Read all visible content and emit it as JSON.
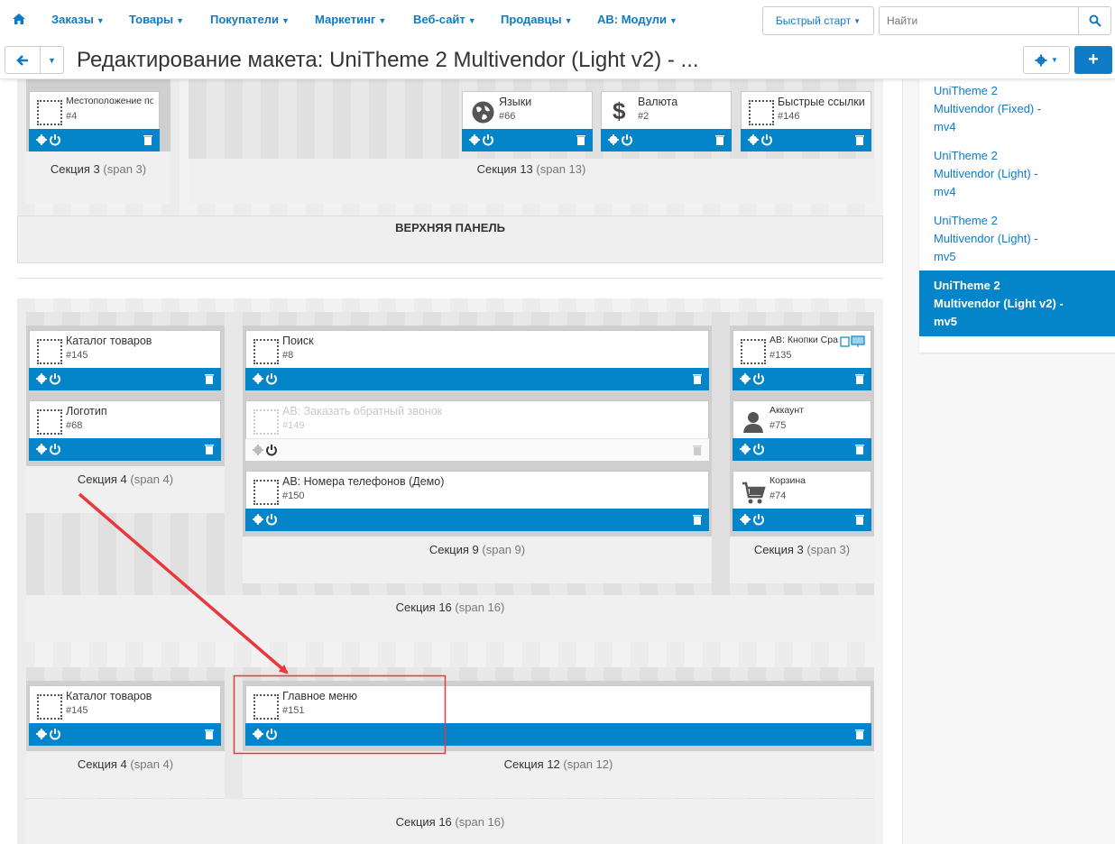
{
  "nav": {
    "items": [
      {
        "label": "Заказы"
      },
      {
        "label": "Товары"
      },
      {
        "label": "Покупатели"
      },
      {
        "label": "Маркетинг"
      },
      {
        "label": "Веб-сайт"
      },
      {
        "label": "Продавцы"
      },
      {
        "label": "AB: Модули"
      }
    ],
    "quick_start": "Быстрый старт",
    "search_placeholder": "Найти"
  },
  "header": {
    "title": "Редактирование макета: UniTheme 2 Multivendor (Light v2) - ..."
  },
  "sidebar": {
    "links": [
      {
        "line1": "UniTheme 2",
        "line2": "Multivendor (Fixed) -",
        "line3": "mv4"
      },
      {
        "line1": "UniTheme 2",
        "line2": "Multivendor (Light) -",
        "line3": "mv4"
      },
      {
        "line1": "UniTheme 2",
        "line2": "Multivendor (Light) -",
        "line3": "mv5"
      },
      {
        "line1": "UniTheme 2",
        "line2": "Multivendor (Light v2) -",
        "line3": "mv5"
      }
    ]
  },
  "top_panel": {
    "title": "ВЕРХНЯЯ ПАНЕЛЬ",
    "sections": [
      {
        "label": "Секция 3",
        "span": "(span 3)"
      },
      {
        "label": "Секция 13",
        "span": "(span 13)"
      }
    ],
    "blocks": [
      {
        "name": "Местоположение по...",
        "id": "#4"
      },
      {
        "name": "Языки",
        "id": "#66"
      },
      {
        "name": "Валюта",
        "id": "#2"
      },
      {
        "name": "Быстрые ссылки",
        "id": "#146"
      }
    ]
  },
  "header_panel": {
    "sections": [
      {
        "label": "Секция 4",
        "span": "(span 4)"
      },
      {
        "label": "Секция 9",
        "span": "(span 9)"
      },
      {
        "label": "Секция 3",
        "span": "(span 3)"
      },
      {
        "label": "Секция 16",
        "span": "(span 16)"
      }
    ],
    "blocks": [
      {
        "name": "Каталог товаров",
        "id": "#145"
      },
      {
        "name": "Логотип",
        "id": "#68"
      },
      {
        "name": "Поиск",
        "id": "#8"
      },
      {
        "name": "AB: Заказать обратный звонок",
        "id": "#149"
      },
      {
        "name": "AB: Номера телефонов (Демо)",
        "id": "#150"
      },
      {
        "name": "AB: Кнопки Сра...",
        "id": "#135"
      },
      {
        "name": "Аккаунт",
        "id": "#75"
      },
      {
        "name": "Корзина",
        "id": "#74"
      }
    ]
  },
  "menu_panel": {
    "sections": [
      {
        "label": "Секция 4",
        "span": "(span 4)"
      },
      {
        "label": "Секция 12",
        "span": "(span 12)"
      },
      {
        "label": "Секция 16",
        "span": "(span 16)"
      }
    ],
    "blocks": [
      {
        "name": "Каталог товаров",
        "id": "#145"
      },
      {
        "name": "Главное меню",
        "id": "#151"
      }
    ]
  },
  "colors": {
    "accent": "#0585c9",
    "link": "#0f7bc6",
    "annotation": "#e8383d"
  }
}
